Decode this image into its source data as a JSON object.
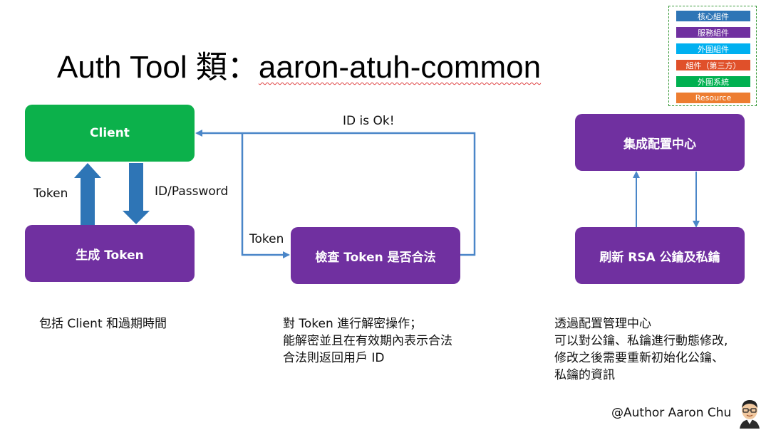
{
  "title": {
    "prefix": "Auth Tool 類：",
    "name": "aaron-atuh-common"
  },
  "legend": {
    "items": [
      {
        "label": "核心組件",
        "color": "#2e75b6"
      },
      {
        "label": "服務組件",
        "color": "#7030a0"
      },
      {
        "label": "外圍組件",
        "color": "#00b0f0"
      },
      {
        "label": "組件（第三方）",
        "color": "#e0502a"
      },
      {
        "label": "外圍系統",
        "color": "#00b050"
      },
      {
        "label": "Resource",
        "color": "#ed7d31"
      }
    ]
  },
  "nodes": {
    "client": "Client",
    "generate_token": "生成 Token",
    "check_token": "檢查 Token 是否合法",
    "config_center": "集成配置中心",
    "refresh_rsa": "刷新 RSA 公鑰及私鑰"
  },
  "edges": {
    "token_up": "Token",
    "id_password": "ID/Password",
    "token_to_check": "Token",
    "id_ok": "ID is Ok!"
  },
  "descriptions": {
    "generate": [
      "包括 Client 和過期時間"
    ],
    "check": [
      "對 Token 進行解密操作；",
      "能解密並且在有效期內表示合法",
      "合法則返回用戶 ID"
    ],
    "refresh": [
      "透過配置管理中心",
      "可以對公鑰、私鑰進行動態修改,",
      "修改之後需要重新初始化公鑰、",
      "私鑰的資訊"
    ]
  },
  "author": "@Author Aaron Chu",
  "colors": {
    "green": "#0cb14b",
    "purple": "#7030a0",
    "arrow_blue": "#2e75b6",
    "connector_blue": "#4a86c8"
  }
}
